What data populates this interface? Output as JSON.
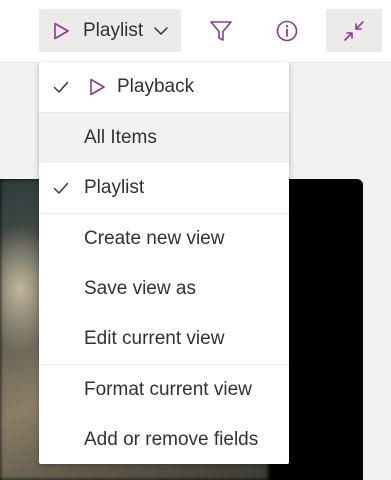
{
  "toolbar": {
    "view_switcher_label": "Playlist",
    "icons": {
      "view": "play-outline-icon",
      "chevron": "chevron-down-icon",
      "filter": "filter-icon",
      "info": "info-icon",
      "collapse": "collapse-icon"
    }
  },
  "menu": {
    "items": [
      {
        "label": "Playback",
        "checked": true,
        "icon": "play-outline-icon"
      },
      {
        "label": "All Items",
        "checked": false,
        "hovered": true
      },
      {
        "label": "Playlist",
        "checked": true
      },
      {
        "label": "Create new view",
        "checked": false
      },
      {
        "label": "Save view as",
        "checked": false
      },
      {
        "label": "Edit current view",
        "checked": false
      },
      {
        "label": "Format current view",
        "checked": false
      },
      {
        "label": "Add or remove fields",
        "checked": false
      }
    ]
  },
  "colors": {
    "accent": "#8a3b8f",
    "text": "#323130",
    "toolbar_button_bg": "#edebe9",
    "page_bg": "#f3f2f1"
  }
}
